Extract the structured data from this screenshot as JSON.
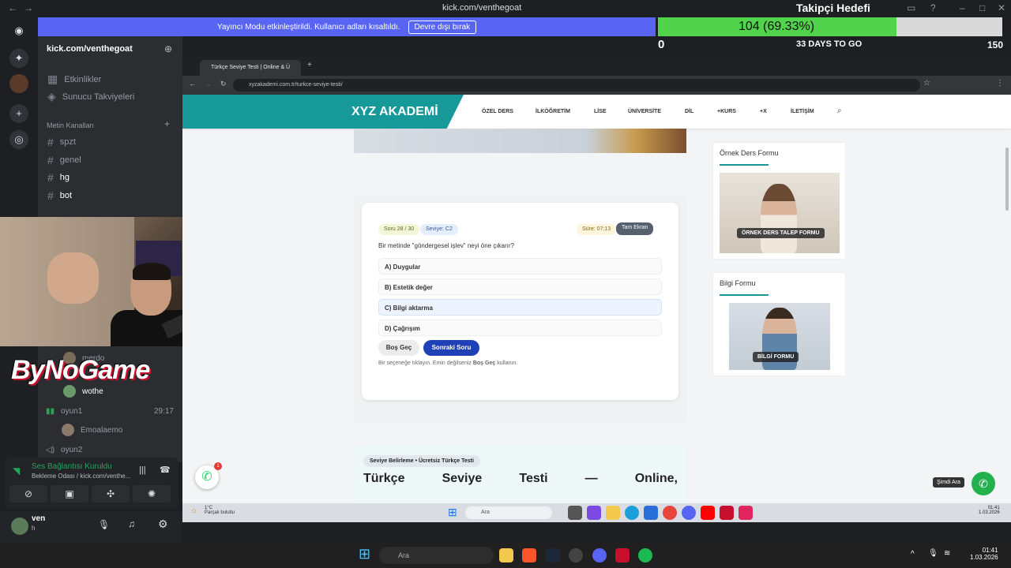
{
  "titlebar": {
    "url": "kick.com/venthegoat"
  },
  "streamer_banner": {
    "text": "Yayıncı Modu etkinleştirildi. Kullanıcı adları kısaltıldı.",
    "button": "Devre dışı bırak"
  },
  "follower_goal": {
    "title": "Takipçi Hedefi",
    "progress_text": "104 (69.33%)",
    "progress_fraction": 0.6933,
    "min": "0",
    "days_left": "33 DAYS TO GO",
    "max": "150"
  },
  "sidebar": {
    "server_name": "kick.com/venthegoat",
    "items": [
      {
        "label": "Etkinlikler"
      },
      {
        "label": "Sunucu Takviyeleri"
      }
    ],
    "category": "Metin Kanalları",
    "channels": [
      {
        "label": "spzt"
      },
      {
        "label": "genel"
      },
      {
        "label": "hg"
      },
      {
        "label": "bot"
      }
    ],
    "voice_users": [
      {
        "label": "merdo"
      },
      {
        "label": "wothe"
      }
    ],
    "voice_channels": [
      {
        "label": "oyun1",
        "timer": "29:17"
      },
      {
        "label": "oyun2"
      }
    ],
    "voice_sub_user": "Emoalaemo"
  },
  "overlay_logo": "ByNoGame",
  "voice_connection": {
    "status": "Ses Bağlantısı Kuruldu",
    "detail": "Bekleme Odası / kick.com/venthe..."
  },
  "user": {
    "name": "ven",
    "status": "h"
  },
  "browser": {
    "tab_title": "Türkçe Seviye Testi | Online & Ü",
    "address": "xyzakademi.com.tr/turkce-seviye-testi/"
  },
  "site": {
    "brand": "XYZ AKADEMİ",
    "menu": [
      "ÖZEL DERS",
      "İLKÖĞRETİM",
      "LİSE",
      "ÜNİVERSİTE",
      "DİL",
      "+KURS",
      "+X",
      "İLETİŞİM"
    ]
  },
  "quiz": {
    "question_counter": "Soru 28 / 30",
    "level": "Seviye: C2",
    "timer": "Süre: 07:13",
    "fullscreen": "Tam Ekran",
    "question": "Bir metinde \"göndergesel işlev\" neyi öne çıkarır?",
    "options": [
      "A) Duygular",
      "B) Estetik değer",
      "C) Bilgi aktarma",
      "D) Çağrışım"
    ],
    "skip": "Boş Geç",
    "next": "Sonraki Soru",
    "hint_prefix": "Bir seçeneğe tıklayın. Emin değilseniz ",
    "hint_bold": "Boş Geç",
    "hint_suffix": " kullanın."
  },
  "promo": {
    "tag": "Seviye Belirleme • Ücretsiz Türkçe Testi",
    "title_words": [
      "Türkçe",
      "Seviye",
      "Testi",
      "—",
      "Online,"
    ]
  },
  "forms": [
    {
      "title": "Örnek Ders Formu",
      "label": "ÖRNEK DERS TALEP FORMU"
    },
    {
      "title": "Bilgi Formu",
      "label": "BİLGİ FORMU"
    }
  ],
  "floating": {
    "whatsapp_badge": "1",
    "call_now": "Şimdi Ara"
  },
  "inner_taskbar": {
    "weather": "1°C",
    "weather_sub": "Parçalı bulutlu",
    "search": "Ara",
    "time": "01:41",
    "date": "1.03.2026"
  },
  "outer_taskbar": {
    "search": "Ara",
    "time": "01:41",
    "date": "1.03.2026"
  },
  "colors": {
    "discord_blurple": "#5865f2",
    "goal_green": "#52d34c",
    "brand_teal": "#17999a",
    "next_blue": "#2040b8"
  }
}
